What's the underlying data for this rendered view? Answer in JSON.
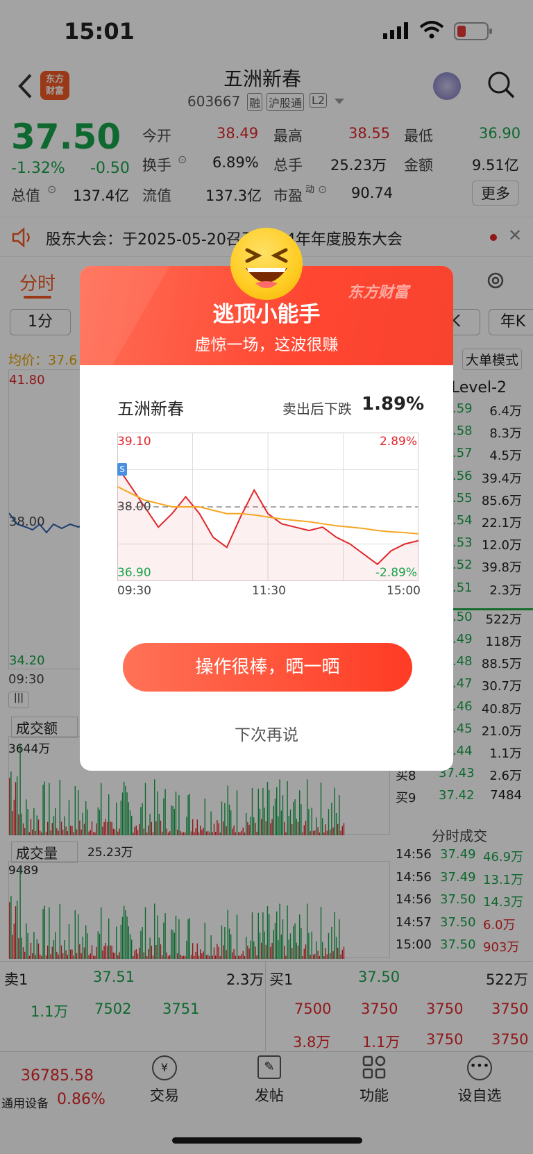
{
  "status": {
    "time": "15:01"
  },
  "header": {
    "title": "五洲新春",
    "code": "603667",
    "tags": [
      "融",
      "沪股通",
      "L2"
    ]
  },
  "quote": {
    "price": "37.50",
    "pct": "-1.32%",
    "chg": "-0.50",
    "row1": [
      {
        "l": "今开",
        "v": "38.49"
      },
      {
        "l": "最高",
        "v": "38.55"
      },
      {
        "l": "最低",
        "v": "36.90"
      }
    ],
    "row2": [
      {
        "l": "换手",
        "v": "6.89%"
      },
      {
        "l": "总手",
        "v": "25.23万"
      },
      {
        "l": "金额",
        "v": "9.51亿"
      }
    ],
    "row3": [
      {
        "l": "总值",
        "v": "137.4亿"
      },
      {
        "l": "流值",
        "v": "137.3亿"
      },
      {
        "l": "市盈",
        "sup": "动",
        "v": "90.74"
      }
    ],
    "more": "更多"
  },
  "notice": {
    "text": "股东大会：于2025-05-20召开2024年年度股东大会"
  },
  "tabs": {
    "active": "分时",
    "period": "1分",
    "right1": "K",
    "right2": "年K"
  },
  "chart_labels": {
    "avg": "均价：37.6",
    "high": "41.80",
    "low": "34.20",
    "mid": "38.00",
    "time": "09:30",
    "big": "大单模式",
    "level2": "Level-2"
  },
  "level2_rows": [
    {
      "p": ".59",
      "v": "6.4万"
    },
    {
      "p": ".58",
      "v": "8.3万"
    },
    {
      "p": ".57",
      "v": "4.5万"
    },
    {
      "p": ".56",
      "v": "39.4万"
    },
    {
      "p": ".55",
      "v": "85.6万"
    },
    {
      "p": ".54",
      "v": "22.1万"
    },
    {
      "p": ".53",
      "v": "12.0万"
    },
    {
      "p": ".52",
      "v": "39.8万"
    },
    {
      "p": ".51",
      "v": "2.3万"
    },
    {
      "p": ".50",
      "v": "522万"
    },
    {
      "p": ".49",
      "v": "118万"
    },
    {
      "p": ".48",
      "v": "88.5万"
    },
    {
      "p": ".47",
      "v": "30.7万"
    },
    {
      "p": ".46",
      "v": "40.8万"
    },
    {
      "p": ".45",
      "v": "21.0万"
    },
    {
      "p": ".44",
      "v": "1.1万"
    },
    {
      "p": "37.43",
      "v": "2.6万",
      "l": "买8"
    },
    {
      "p": "37.42",
      "v": "7484",
      "l": "买9"
    }
  ],
  "vol": {
    "amt_label": "成交额",
    "amt_max": "3644万",
    "vol_label": "成交量",
    "vol_total": "25.23万",
    "vol_max": "9489"
  },
  "ticks": {
    "title": "分时成交",
    "rows": [
      {
        "t": "14:56",
        "p": "37.49",
        "v": "46.9万"
      },
      {
        "t": "14:56",
        "p": "37.49",
        "v": "13.1万"
      },
      {
        "t": "14:56",
        "p": "37.50",
        "v": "14.3万"
      },
      {
        "t": "14:57",
        "p": "37.50",
        "v": "6.0万"
      },
      {
        "t": "15:00",
        "p": "37.50",
        "v": "903万"
      }
    ]
  },
  "book": {
    "sell_label": "卖1",
    "sell_p": "37.51",
    "sell_v": "2.3万",
    "buy_label": "买1",
    "buy_p": "37.50",
    "buy_v": "522万",
    "left_row": [
      "1.1万",
      "7502",
      "3751"
    ],
    "right_row1": [
      "7500",
      "3750",
      "3750",
      "3750"
    ],
    "right_row2": [
      "3.8万",
      "1.1万",
      "3750",
      "3750"
    ]
  },
  "bottom": {
    "index_val": "36785.58",
    "index_name": "通用设备",
    "index_pct": "0.86%",
    "nav": [
      "交易",
      "发帖",
      "功能",
      "设自选"
    ]
  },
  "modal": {
    "title": "逃顶小能手",
    "subtitle": "虚惊一场，这波很赚",
    "brand": "东方财富",
    "stock": "五洲新春",
    "desc": "卖出后下跌",
    "pct": "1.89%",
    "y_top": "39.10",
    "y_bot": "36.90",
    "y_mid": "38.00",
    "pct_top": "2.89%",
    "pct_bot": "-2.89%",
    "times": [
      "09:30",
      "11:30",
      "15:00"
    ],
    "share_btn": "操作很棒，晒一晒",
    "later": "下次再说"
  },
  "chart_data": {
    "type": "line",
    "title": "五洲新春",
    "x": [
      "09:30",
      "11:30",
      "15:00"
    ],
    "ylim": [
      36.9,
      39.1
    ],
    "series": [
      {
        "values": [
          38.6,
          38.3,
          38.0,
          37.7,
          37.9,
          38.15,
          37.9,
          37.55,
          37.4,
          37.85,
          38.25,
          37.9,
          37.75,
          37.7,
          37.65,
          37.7,
          37.55,
          37.45,
          37.3,
          37.15,
          37.35,
          37.45,
          37.5
        ]
      },
      {
        "values": [
          38.3,
          38.2,
          38.1,
          38.05,
          38.0,
          38.0,
          38.0,
          37.95,
          37.9,
          37.9,
          37.88,
          37.85,
          37.82,
          37.8,
          37.78,
          37.75,
          37.72,
          37.7,
          37.68,
          37.65,
          37.63,
          37.62,
          37.6
        ]
      }
    ]
  }
}
